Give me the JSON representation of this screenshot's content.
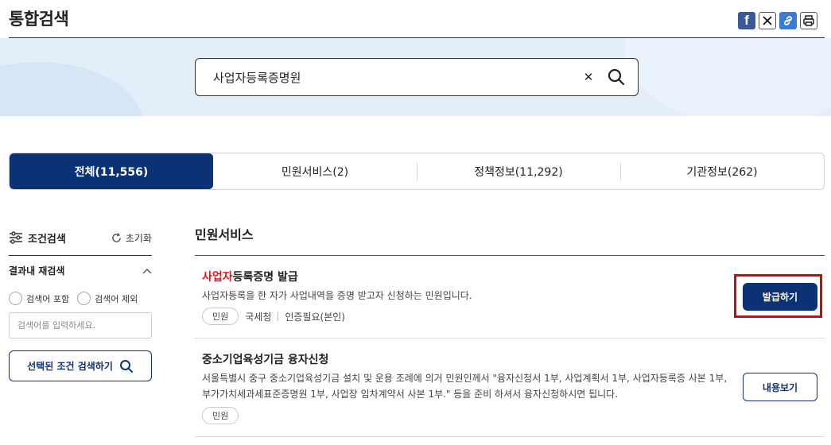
{
  "header": {
    "title": "통합검색",
    "share_icons": [
      "facebook-icon",
      "x-icon",
      "link-icon",
      "print-icon"
    ],
    "facebook_glyph": "f"
  },
  "search": {
    "value": "사업자등록증명원",
    "clear_glyph": "✕"
  },
  "tabs": [
    {
      "label": "전체(11,556)",
      "active": true
    },
    {
      "label": "민원서비스(2)",
      "active": false
    },
    {
      "label": "정책정보(11,292)",
      "active": false
    },
    {
      "label": "기관정보(262)",
      "active": false
    }
  ],
  "sidebar": {
    "filter_title": "조건검색",
    "reset_label": "초기화",
    "refine_title": "결과내 재검색",
    "include_label": "검색어 포함",
    "exclude_label": "검색어 제외",
    "keyword_placeholder": "검색어를 입력하세요.",
    "search_button": "선택된 조건 검색하기"
  },
  "main": {
    "section_title": "민원서비스",
    "results": [
      {
        "title_highlight": "사업자",
        "title_rest": "등록증명 발급",
        "description": "사업자등록을 한 자가 사업내역을 증명 받고자 신청하는 민원입니다.",
        "tag": "민원",
        "agency": "국세청",
        "auth": "인증필요(본인)",
        "button": "발급하기"
      },
      {
        "title": "중소기업육성기금 융자신청",
        "description": "서울특별시 중구 중소기업육성기금 설치 및 운용 조례에 의거 민원인께서 \"융자신청서 1부, 사업계획서 1부, 사업자등록증 사본 1부, 부가가치세과세표준증명원 1부, 사업장 임차계약서 사본 1부.\" 등을 준비 하셔서 융자신청하시면 됩니다.",
        "tag": "민원",
        "button": "내용보기"
      }
    ]
  },
  "colors": {
    "primary": "#0b3274",
    "highlight": "#e4141b",
    "banner": "#e3eef9",
    "annotation_frame": "#e00000"
  }
}
